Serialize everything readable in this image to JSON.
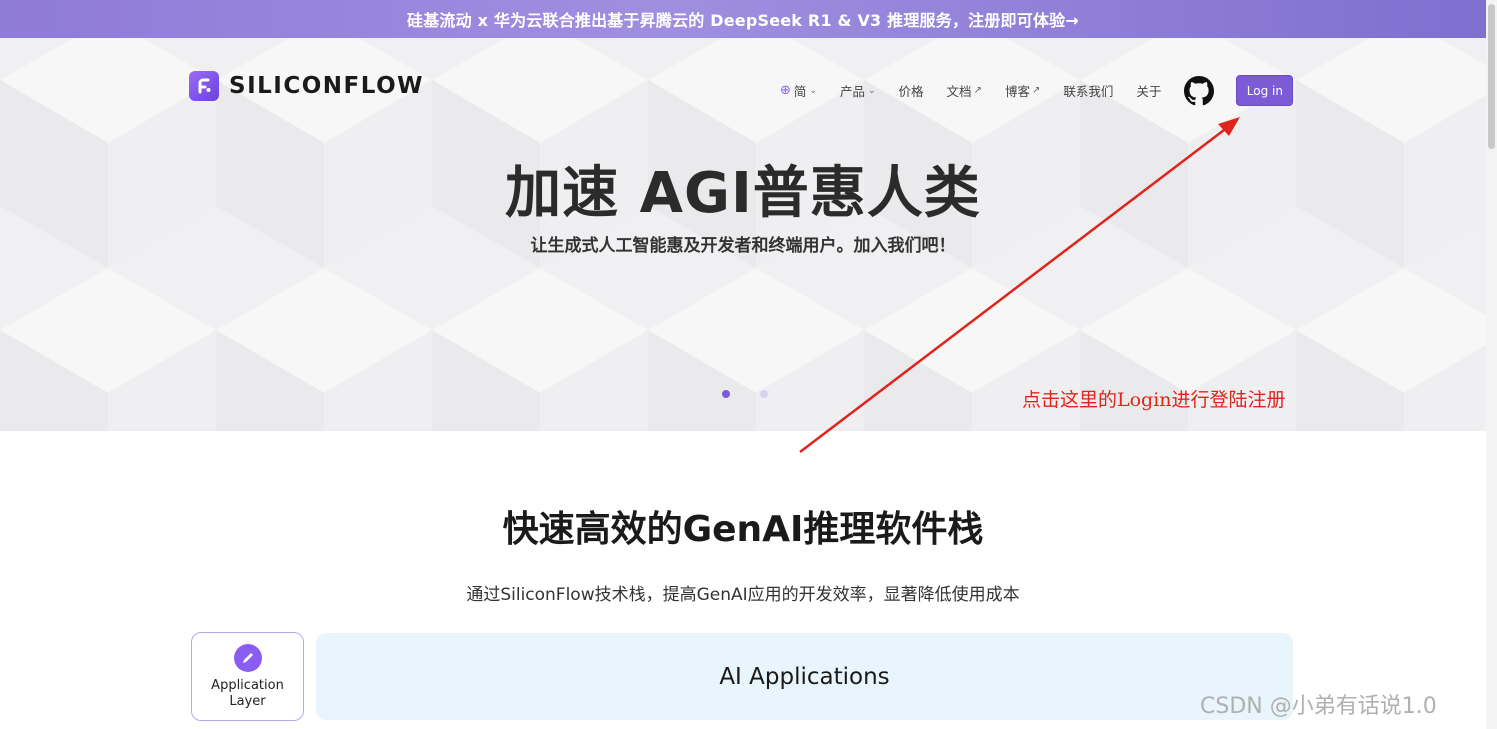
{
  "banner": {
    "text": "硅基流动 x 华为云联合推出基于昇腾云的 DeepSeek R1 & V3 推理服务，注册即可体验→"
  },
  "header": {
    "logo_text": "SILICONFLOW",
    "nav": {
      "lang": "简",
      "products": "产品",
      "pricing": "价格",
      "docs": "文档",
      "blog": "博客",
      "contact": "联系我们",
      "about": "关于"
    },
    "login_label": "Log in"
  },
  "hero": {
    "title": "加速 AGI普惠人类",
    "subtitle": "让生成式人工智能惠及开发者和终端用户。加入我们吧！",
    "carousel_total": 2,
    "carousel_active": 1
  },
  "annotation": {
    "text": "点击这里的Login进行登陆注册",
    "color": "#e0241b"
  },
  "section": {
    "title": "快速高效的GenAI推理软件栈",
    "subtitle": "通过SiliconFlow技术栈，提高GenAI应用的开发效率，显著降低使用成本",
    "layer_label_line1": "Application",
    "layer_label_line2": "Layer",
    "apps_label": "AI Applications"
  },
  "watermark": "CSDN @小弟有话说1.0",
  "colors": {
    "accent": "#7c5cd6",
    "apps_bg": "#e8f5fc",
    "banner": "#9a88dd"
  }
}
